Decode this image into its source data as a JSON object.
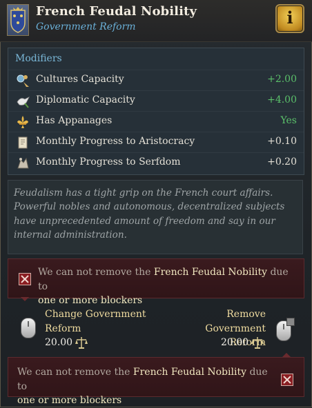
{
  "header": {
    "title": "French Feudal Nobility",
    "subtitle": "Government Reform",
    "info_label": "i"
  },
  "modifiers": {
    "heading": "Modifiers",
    "rows": [
      {
        "label": "Cultures Capacity",
        "value": "+2.00",
        "icon": "cultures-icon",
        "positive": true
      },
      {
        "label": "Diplomatic Capacity",
        "value": "+4.00",
        "icon": "dove-icon",
        "positive": true
      },
      {
        "label": "Has Appanages",
        "value": "Yes",
        "icon": "fleur-de-lis-icon",
        "positive": true
      },
      {
        "label": "Monthly Progress to Aristocracy",
        "value": "+0.10",
        "icon": "scroll-icon",
        "positive": false
      },
      {
        "label": "Monthly Progress to Serfdom",
        "value": "+0.20",
        "icon": "serf-icon",
        "positive": false
      }
    ]
  },
  "description": "Feudalism has a tight grip on the French court affairs. Powerful nobles and autonomous, decentralized subjects have unprecedented amount of freedom and say in our internal administration.",
  "warning": {
    "prefix": "We can not remove the",
    "name": "French Feudal Nobility",
    "middle": "due to",
    "blockers": "one or more blockers"
  },
  "actions": {
    "change": {
      "line1": "Change Government",
      "line2": "Reform",
      "cost": "20.00"
    },
    "remove": {
      "line1": "Remove Government",
      "line2": "Reform",
      "cost": "20.00"
    }
  },
  "colors": {
    "accent_blue": "#6ab0d8",
    "positive_green": "#5bc06a",
    "gold": "#f0dca0",
    "warning_bg": "#3a1a1e"
  }
}
